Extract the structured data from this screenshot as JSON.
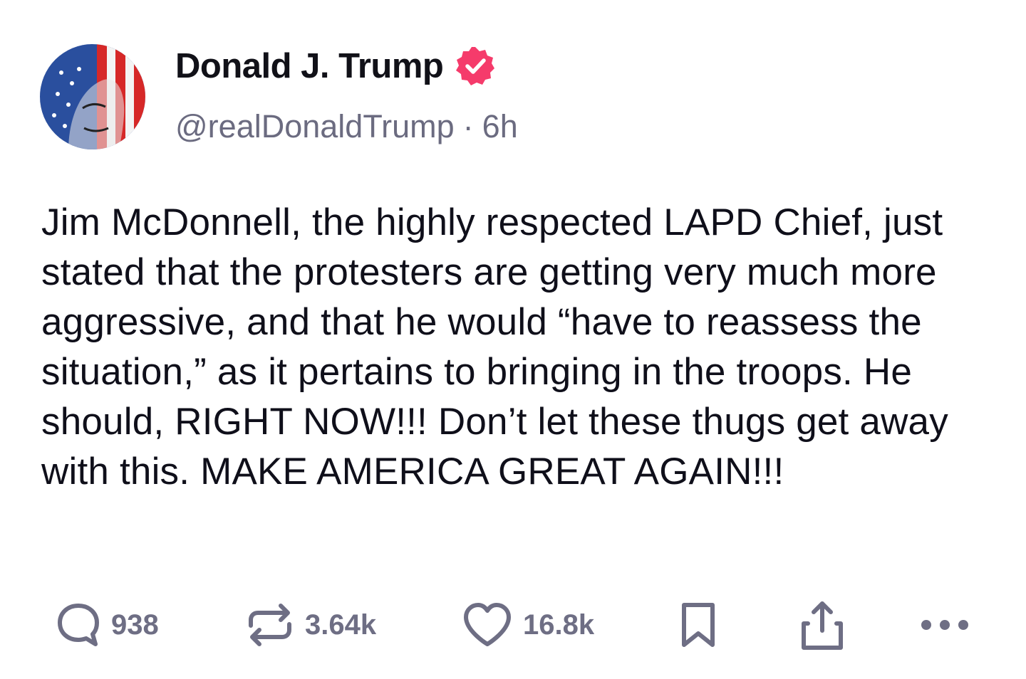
{
  "author": {
    "display_name": "Donald J. Trump",
    "handle": "@realDonaldTrump",
    "separator": "·",
    "time_ago": "6h",
    "verified_badge_icon": "verified-badge-icon",
    "avatar_icon": "avatar-flag-portrait"
  },
  "post": {
    "text": "Jim McDonnell, the highly respected LAPD Chief, just stated that the protesters are getting very much more aggressive, and that he would “have to reassess the situation,” as it pertains to bringing in the troops. He should, RIGHT NOW!!! Don’t let these thugs get away with this. MAKE AMERICA GREAT AGAIN!!!"
  },
  "actions": {
    "reply_count": "938",
    "repost_count": "3.64k",
    "like_count": "16.8k",
    "icons": [
      "reply-icon",
      "repost-icon",
      "heart-icon",
      "bookmark-icon",
      "share-icon",
      "more-icon"
    ]
  },
  "colors": {
    "verified_badge": "#f53b6b",
    "text_primary": "#0f0f1a",
    "text_secondary": "#6b6b80",
    "action_gray": "#6e6e84"
  }
}
